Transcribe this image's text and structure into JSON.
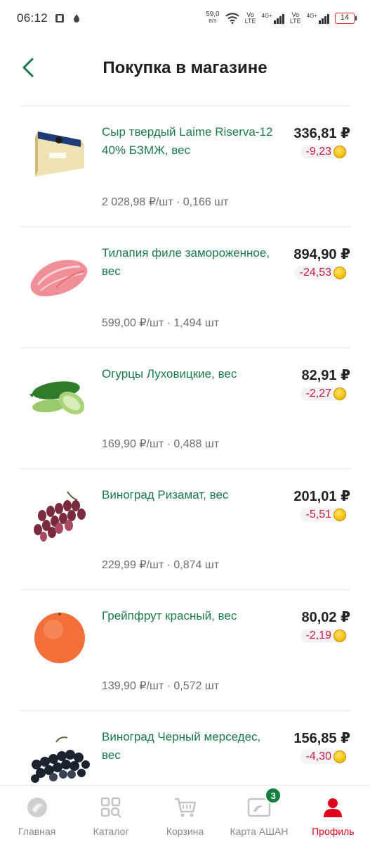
{
  "status_bar": {
    "time": "06:12",
    "net_speed": "59,0",
    "net_unit": "B/S",
    "volte1_top": "Vo",
    "volte1_bottom": "LTE",
    "sig1_label": "4G+",
    "volte2_top": "Vo",
    "volte2_bottom": "LTE",
    "sig2_label": "4G+",
    "battery": "14"
  },
  "header": {
    "title": "Покупка в магазине"
  },
  "items": [
    {
      "name": "Сыр твердый Laime Riserva-12 40% БЗМЖ, вес",
      "price": "336,81 ₽",
      "bonus": "-9,23",
      "unit": "2 028,98 ₽/шт · 0,166 шт",
      "icon": "cheese-icon"
    },
    {
      "name": "Тилапия филе замороженное, вес",
      "price": "894,90 ₽",
      "bonus": "-24,53",
      "unit": "599,00 ₽/шт · 1,494 шт",
      "icon": "fish-fillet-icon"
    },
    {
      "name": "Огурцы Луховицкие, вес",
      "price": "82,91 ₽",
      "bonus": "-2,27",
      "unit": "169,90 ₽/шт · 0,488 шт",
      "icon": "cucumber-icon"
    },
    {
      "name": "Виноград Ризамат, вес",
      "price": "201,01 ₽",
      "bonus": "-5,51",
      "unit": "229,99 ₽/шт · 0,874 шт",
      "icon": "red-grapes-icon"
    },
    {
      "name": "Грейпфрут красный, вес",
      "price": "80,02 ₽",
      "bonus": "-2,19",
      "unit": "139,90 ₽/шт · 0,572 шт",
      "icon": "grapefruit-icon"
    },
    {
      "name": "Виноград Черный мерседес, вес",
      "price": "156,85 ₽",
      "bonus": "-4,30",
      "unit": "",
      "icon": "black-grapes-icon"
    }
  ],
  "nav": {
    "home": "Главная",
    "catalog": "Каталог",
    "cart": "Корзина",
    "card": "Карта АШАН",
    "card_badge": "3",
    "profile": "Профиль"
  },
  "colors": {
    "accent_green": "#1a7a4c",
    "bonus_red": "#d0174a",
    "active_red": "#e3001b",
    "badge_green": "#15803d"
  }
}
